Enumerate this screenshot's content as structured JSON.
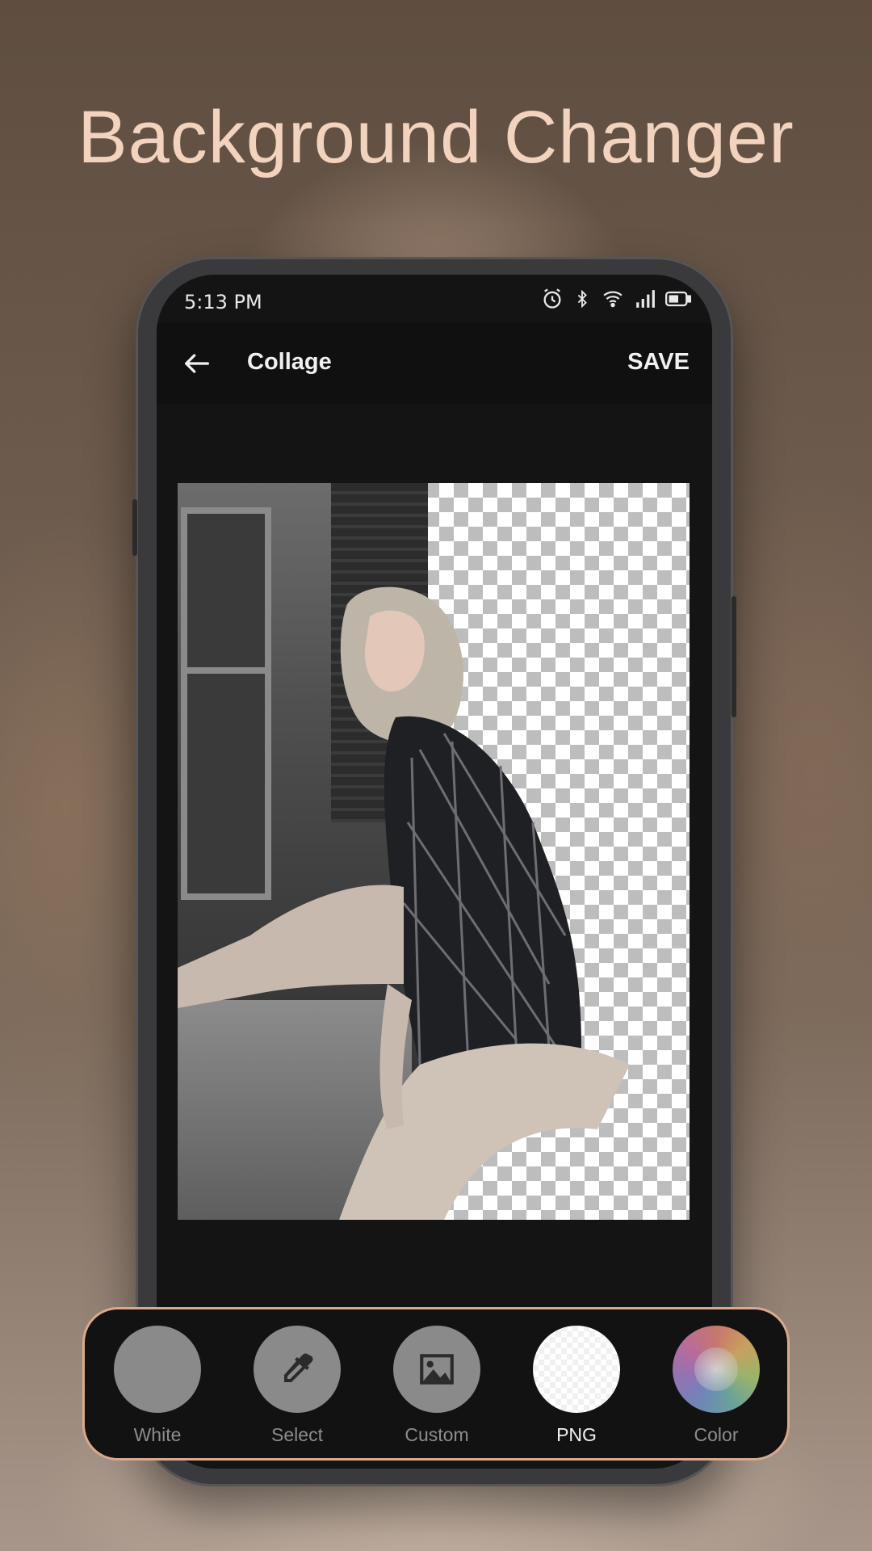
{
  "headline": "Background Changer",
  "status_bar": {
    "time": "5:13 PM",
    "icons": [
      "alarm-icon",
      "bluetooth-icon",
      "wifi-icon",
      "signal-icon",
      "battery-icon"
    ]
  },
  "app_bar": {
    "back_icon": "arrow-left-icon",
    "title": "Collage",
    "save_label": "SAVE"
  },
  "background_options": [
    {
      "label": "White",
      "icon": "none",
      "color": "#8a8a8a"
    },
    {
      "label": "Select",
      "icon": "eyedropper-icon",
      "color": "#8a8a8a"
    },
    {
      "label": "Custom",
      "icon": "image-icon",
      "color": "#8a8a8a"
    },
    {
      "label": "PNG",
      "icon": "transparent-checker",
      "color": "#ffffff",
      "selected": true
    },
    {
      "label": "Color",
      "icon": "color-wheel-icon",
      "color": "#b07a7a"
    }
  ],
  "colors": {
    "accent": "#d9a98b",
    "headline": "#f2d3bd",
    "screen_bg": "#141414"
  }
}
